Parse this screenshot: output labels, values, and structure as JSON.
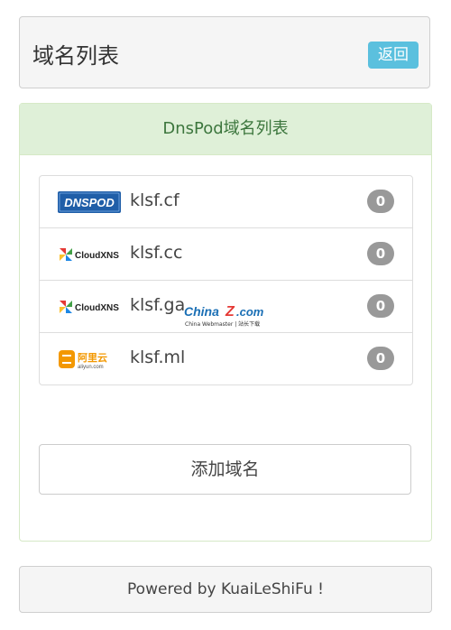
{
  "header": {
    "title": "域名列表",
    "back_label": "返回"
  },
  "panel": {
    "heading": "DnsPod域名列表",
    "domains": [
      {
        "provider": "dnspod-logo",
        "name": "klsf.cf",
        "count": "0"
      },
      {
        "provider": "cloudxns-logo",
        "name": "klsf.cc",
        "count": "0"
      },
      {
        "provider": "cloudxns-logo",
        "name": "klsf.ga",
        "count": "0"
      },
      {
        "provider": "aliyun-logo",
        "name": "klsf.ml",
        "count": "0"
      }
    ],
    "add_label": "添加域名"
  },
  "logos": {
    "dnspod": "DNSPOD",
    "cloudxns": "CloudXNS",
    "aliyun_cn": "阿里云",
    "aliyun_en": "aliyun.com"
  },
  "watermark": {
    "main": "China",
    "z": "Z",
    "suffix": ".com",
    "sub": "China Webmaster | 站长下载"
  },
  "footer": {
    "text": "Powered by KuaiLeShiFu !"
  },
  "colors": {
    "info": "#5bc0de",
    "success_bg": "#dff0d8",
    "success_text": "#3c763d",
    "badge": "#999999"
  }
}
